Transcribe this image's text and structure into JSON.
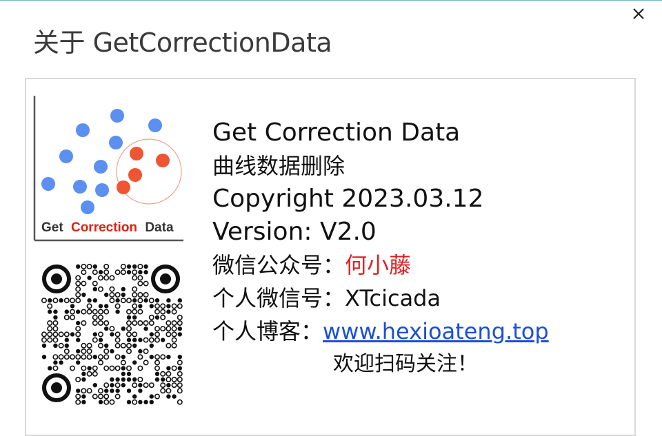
{
  "dialog": {
    "title": "关于 GetCorrectionData",
    "close_icon": "close-icon"
  },
  "logo": {
    "text_get": "Get",
    "text_correction": "Correction",
    "text_data": "Data",
    "colors": {
      "blue": "#5b8ff0",
      "red": "#ee5533",
      "axis": "#555555"
    }
  },
  "qr": {
    "icon": "qr-code-icon"
  },
  "info": {
    "app_name": "Get Correction Data",
    "subtitle": "曲线数据删除",
    "copyright": "Copyright 2023.03.12",
    "version": "Version: V2.0",
    "wechat_public_label": "微信公众号：",
    "wechat_public_value": "何小藤",
    "wechat_personal_label": "个人微信号：",
    "wechat_personal_value": "XTcicada",
    "blog_label": "个人博客：",
    "blog_url": "www.hexioateng.top",
    "welcome": "欢迎扫码关注！"
  }
}
